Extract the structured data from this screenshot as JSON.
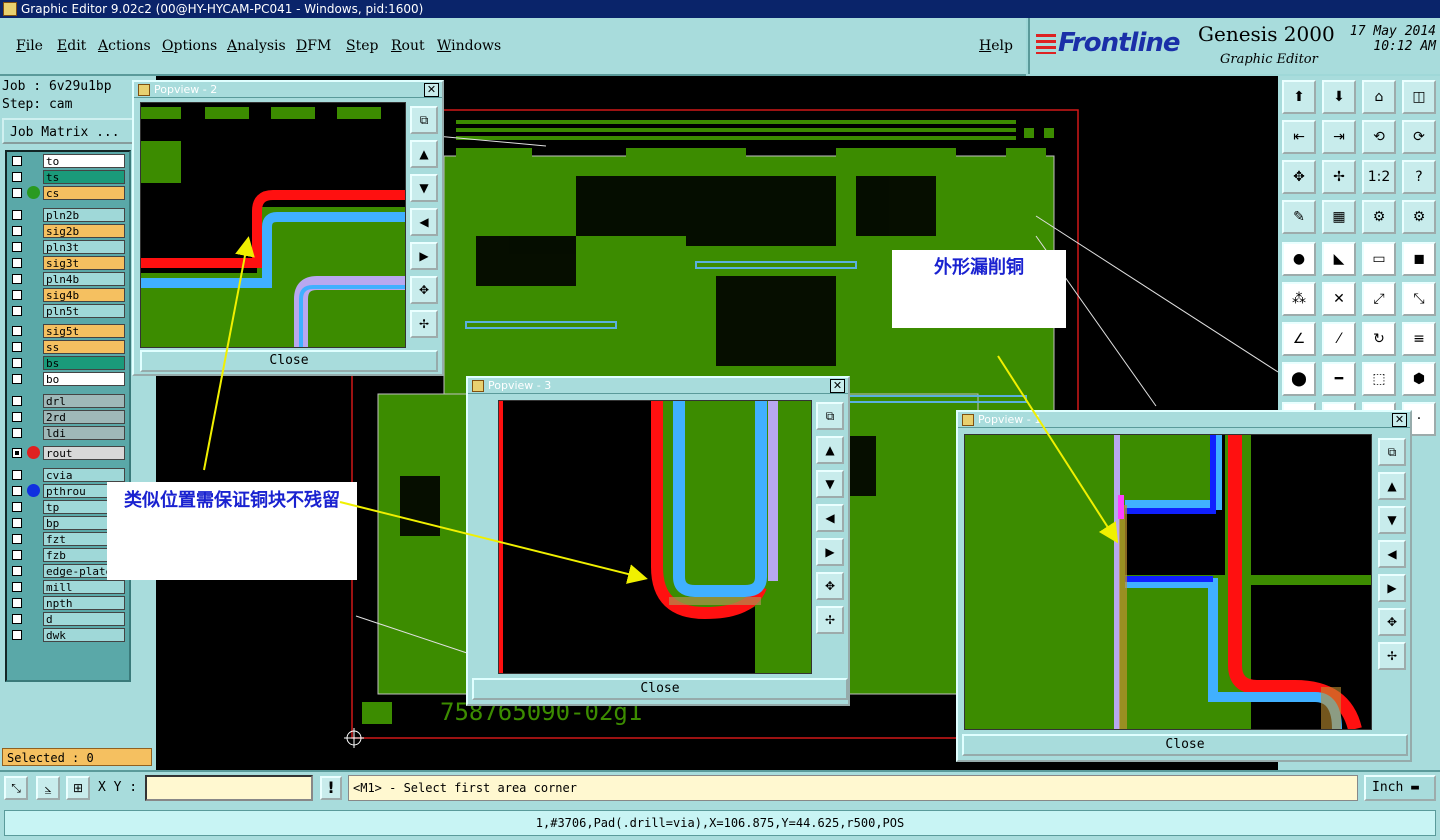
{
  "window": {
    "title": "Graphic Editor 9.02c2 (00@HY-HYCAM-PC041 - Windows, pid:1600)"
  },
  "menu": {
    "items": [
      "File",
      "Edit",
      "Actions",
      "Options",
      "Analysis",
      "DFM",
      "Step",
      "Rout",
      "Windows"
    ],
    "help": "Help"
  },
  "brand": {
    "logo": "Frontline",
    "product": "Genesis 2000",
    "subtitle": "Graphic Editor",
    "date": "17 May 2014",
    "time": "10:12 AM"
  },
  "job": {
    "job_line": "Job : 6v29u1bp",
    "step_line": "Step: cam",
    "matrix_button": "Job Matrix ..."
  },
  "layers": [
    {
      "name": "to",
      "color": "#ffffff",
      "dot": ""
    },
    {
      "name": "ts",
      "color": "#1a9a7a",
      "dot": ""
    },
    {
      "name": "cs",
      "color": "#f5c060",
      "dot": "#2a9a20"
    },
    {
      "name": "pln2b",
      "color": "#9fd8d8",
      "dot": ""
    },
    {
      "name": "sig2b",
      "color": "#f5c060",
      "dot": ""
    },
    {
      "name": "pln3t",
      "color": "#9fd8d8",
      "dot": ""
    },
    {
      "name": "sig3t",
      "color": "#f5c060",
      "dot": ""
    },
    {
      "name": "pln4b",
      "color": "#9fd8d8",
      "dot": ""
    },
    {
      "name": "sig4b",
      "color": "#f5c060",
      "dot": ""
    },
    {
      "name": "pln5t",
      "color": "#9fd8d8",
      "dot": ""
    },
    {
      "name": "sig5t",
      "color": "#f5c060",
      "dot": ""
    },
    {
      "name": "ss",
      "color": "#f5c060",
      "dot": ""
    },
    {
      "name": "bs",
      "color": "#1a9a7a",
      "dot": ""
    },
    {
      "name": "bo",
      "color": "#ffffff",
      "dot": ""
    },
    {
      "name": "drl",
      "color": "#9fb8b8",
      "dot": ""
    },
    {
      "name": "2rd",
      "color": "#9fb8b8",
      "dot": ""
    },
    {
      "name": "ldi",
      "color": "#9fb8b8",
      "dot": ""
    },
    {
      "name": "rout",
      "color": "#d8d8d8",
      "dot": "#e02020"
    },
    {
      "name": "cvia",
      "color": "#9fd8d8",
      "dot": ""
    },
    {
      "name": "pthrou",
      "color": "#9fd8d8",
      "dot": "#1030e0"
    },
    {
      "name": "tp",
      "color": "#9fd8d8",
      "dot": ""
    },
    {
      "name": "bp",
      "color": "#9fd8d8",
      "dot": ""
    },
    {
      "name": "fzt",
      "color": "#9fd8d8",
      "dot": ""
    },
    {
      "name": "fzb",
      "color": "#9fd8d8",
      "dot": ""
    },
    {
      "name": "edge-plated",
      "color": "#9fd8d8",
      "dot": ""
    },
    {
      "name": "mill",
      "color": "#9fd8d8",
      "dot": ""
    },
    {
      "name": "npth",
      "color": "#9fd8d8",
      "dot": ""
    },
    {
      "name": "d",
      "color": "#9fd8d8",
      "dot": ""
    },
    {
      "name": "dwk",
      "color": "#9fd8d8",
      "dot": ""
    }
  ],
  "selected": "Selected : 0",
  "board": {
    "marking": "758765090-02g1"
  },
  "popviews": [
    {
      "title": "Popview - 2",
      "close": "Close"
    },
    {
      "title": "Popview - 3",
      "close": "Close"
    },
    {
      "title": "Popview - 1",
      "close": "Close"
    }
  ],
  "notes": {
    "top": "外形漏削铜",
    "left": "类似位置需保证铜块不残留"
  },
  "bottom": {
    "xy_label": "X Y :",
    "xy_value": "",
    "prompt": "<M1> - Select first area corner",
    "unit": "Inch"
  },
  "status": "1,#3706,Pad(.drill=via),X=106.875,Y=44.625,r500,POS",
  "colors": {
    "board": "#3c8c00",
    "rout": "#ff1010",
    "cyan_trace": "#40b0ff",
    "lilac_trace": "#b8a8f0",
    "panel": "#a8dcdc"
  }
}
